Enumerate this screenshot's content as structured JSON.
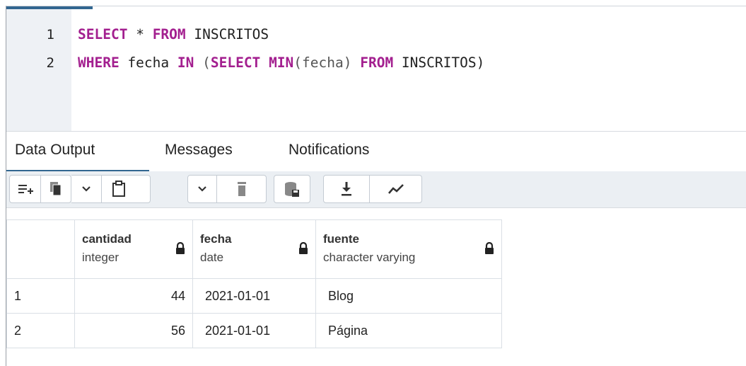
{
  "editor": {
    "lines": [
      {
        "number": "1",
        "tokens": [
          {
            "t": "SELECT",
            "k": "kw"
          },
          {
            "t": " * ",
            "k": "op"
          },
          {
            "t": "FROM",
            "k": "kw"
          },
          {
            "t": " INSCRITOS",
            "k": "op"
          }
        ]
      },
      {
        "number": "2",
        "tokens": [
          {
            "t": "WHERE",
            "k": "kw"
          },
          {
            "t": " fecha ",
            "k": "op"
          },
          {
            "t": "IN",
            "k": "kw"
          },
          {
            "t": " (",
            "k": "pn"
          },
          {
            "t": "SELECT",
            "k": "kw"
          },
          {
            "t": " ",
            "k": "op"
          },
          {
            "t": "MIN",
            "k": "kw"
          },
          {
            "t": "(fecha) ",
            "k": "pn"
          },
          {
            "t": "FROM",
            "k": "kw"
          },
          {
            "t": " INSCRITOS)",
            "k": "op"
          }
        ]
      }
    ]
  },
  "tabs": [
    "Data Output",
    "Messages",
    "Notifications"
  ],
  "toolbar": {
    "icons": [
      "add-row-icon",
      "copy-icon",
      "chevron-down-icon",
      "paste-icon",
      "chevron-down-icon",
      "delete-icon",
      "save-data-icon",
      "download-icon",
      "graph-icon"
    ]
  },
  "grid": {
    "columns": [
      {
        "name": "cantidad",
        "type": "integer"
      },
      {
        "name": "fecha",
        "type": "date"
      },
      {
        "name": "fuente",
        "type": "character varying"
      }
    ],
    "rows": [
      {
        "num": "1",
        "cantidad": "44",
        "fecha": "2021-01-01",
        "fuente": "Blog"
      },
      {
        "num": "2",
        "cantidad": "56",
        "fecha": "2021-01-01",
        "fuente": "Página"
      }
    ]
  },
  "colors": {
    "keyword": "#a31f8f",
    "accent": "#326690",
    "gutter": "#eef1f5",
    "toolbar": "#ebeff3"
  }
}
